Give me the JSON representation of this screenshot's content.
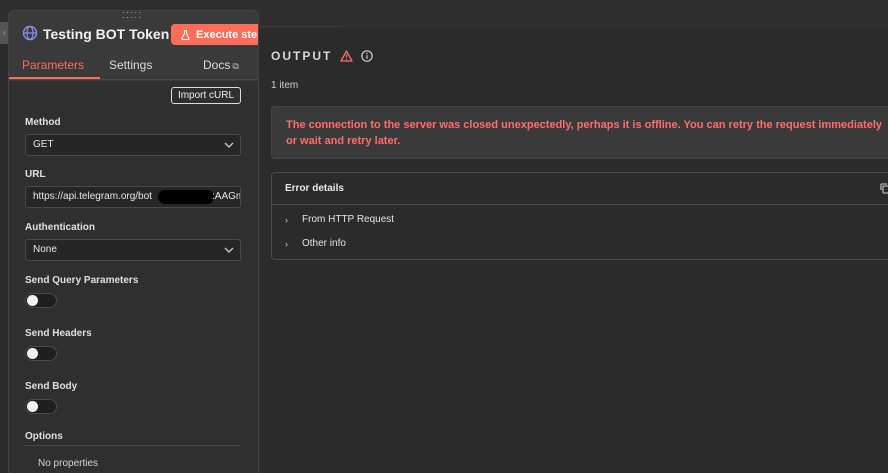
{
  "node": {
    "title": "Testing BOT Token",
    "execute_label": "Execute step",
    "drag_handle": ":::::"
  },
  "tabs": [
    {
      "label": "Parameters"
    },
    {
      "label": "Settings"
    },
    {
      "label": "Docs"
    }
  ],
  "params": {
    "import_label": "Import cURL",
    "method_label": "Method",
    "method_value": "GET",
    "url_label": "URL",
    "url_value": "https://api.telegram.org/bot",
    "url_tail": ":AAGm",
    "auth_label": "Authentication",
    "auth_value": "None",
    "send_query_label": "Send Query Parameters",
    "send_headers_label": "Send Headers",
    "send_body_label": "Send Body",
    "send_query_on": false,
    "send_headers_on": false,
    "send_body_on": false,
    "options_label": "Options",
    "no_properties": "No properties"
  },
  "output": {
    "title": "OUTPUT",
    "item_count": "1 item",
    "error_message": "The connection to the server was closed unexpectedly, perhaps it is offline. You can retry the request immediately or wait and retry later.",
    "details_title": "Error details",
    "rows": [
      {
        "label": "From HTTP Request"
      },
      {
        "label": "Other info"
      }
    ]
  },
  "colors": {
    "accent": "#ff6d5a",
    "error_text": "#ff6d6d",
    "warning_icon": "#ff6d6d"
  }
}
